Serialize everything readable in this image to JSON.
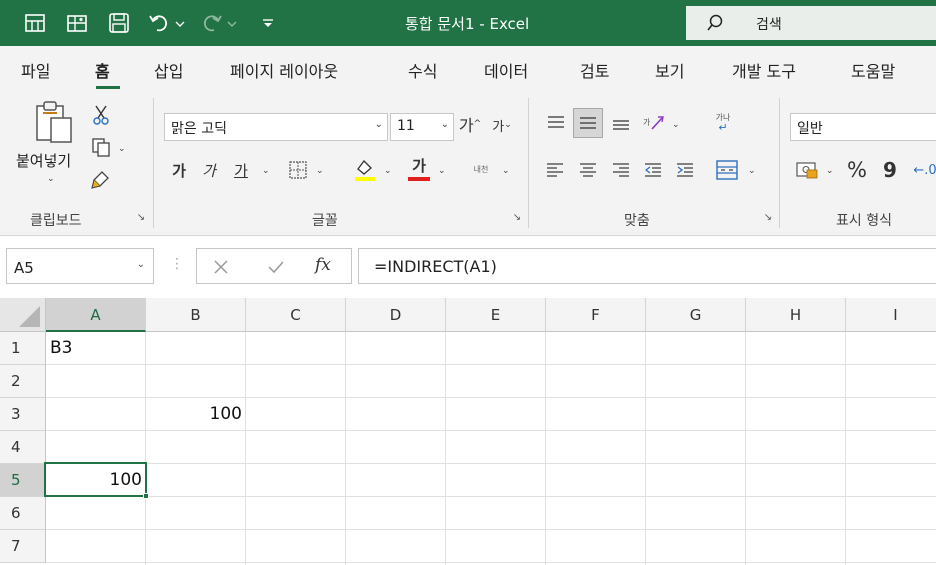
{
  "window": {
    "title": "통합 문서1  -  Excel",
    "search_label": "검색"
  },
  "quick_access": {
    "icons": [
      "save-icon",
      "undo-icon",
      "redo-icon",
      "customize-icon"
    ]
  },
  "tabs": [
    "파일",
    "홈",
    "삽입",
    "페이지 레이아웃",
    "수식",
    "데이터",
    "검토",
    "보기",
    "개발 도구",
    "도움말"
  ],
  "active_tab": "홈",
  "ribbon": {
    "clipboard": {
      "paste_label": "붙여넣기",
      "group_label": "클립보드"
    },
    "font": {
      "font_name": "맑은 고딕",
      "font_size": "11",
      "bold_glyph": "가",
      "italic_glyph": "가",
      "underline_glyph": "가",
      "font_color_glyph": "가",
      "grow_glyph": "가",
      "shrink_glyph": "가",
      "phonetic_glyph": "내천",
      "group_label": "글꼴"
    },
    "alignment": {
      "wrap_glyph": "가나",
      "group_label": "맞춤"
    },
    "number": {
      "format": "일반",
      "percent": "%",
      "comma": "9",
      "group_label": "표시 형식"
    }
  },
  "formula_bar": {
    "name_box": "A5",
    "fx_label": "fx",
    "formula": "=INDIRECT(A1)"
  },
  "sheet": {
    "columns": [
      "A",
      "B",
      "C",
      "D",
      "E",
      "F",
      "G",
      "H",
      "I"
    ],
    "rows": [
      "1",
      "2",
      "3",
      "4",
      "5",
      "6",
      "7"
    ],
    "selected_column": "A",
    "selected_row": "5",
    "cells": {
      "A1": "B3",
      "B3": "100",
      "A5": "100"
    },
    "accent_color": "#217346"
  }
}
